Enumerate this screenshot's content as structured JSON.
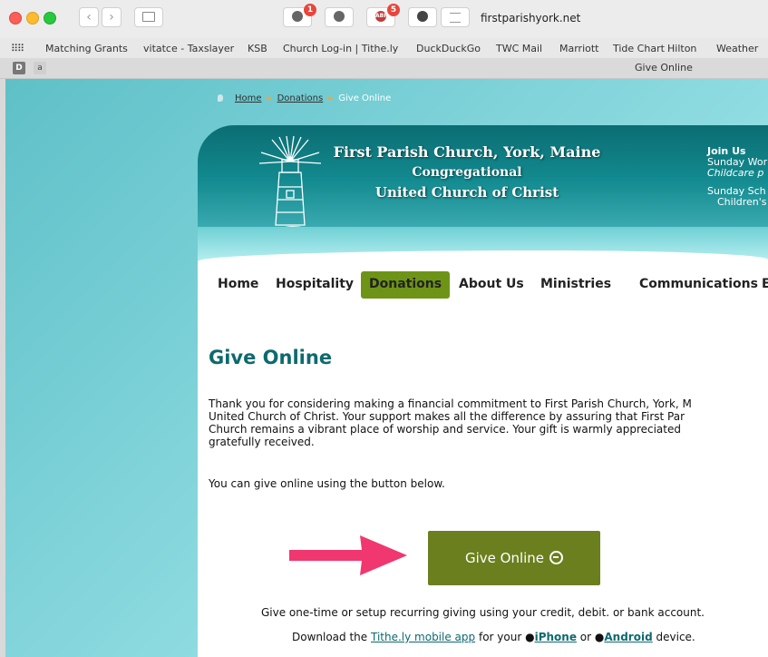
{
  "browser": {
    "url": "firstparishyork.net",
    "tab_title": "Give Online",
    "extension_badges": [
      "1",
      "5"
    ],
    "extension_labels": [
      "ABP"
    ],
    "bookmarks": [
      "Matching Grants",
      "vitatce - Taxslayer",
      "KSB",
      "Church Log-in | Tithe.ly",
      "DuckDuckGo",
      "TWC Mail",
      "Marriott",
      "Tide Chart",
      "Hilton",
      "Weather"
    ],
    "tab_icons": [
      "D",
      "a"
    ]
  },
  "breadcrumb": {
    "home": "Home",
    "donations": "Donations",
    "current": "Give Online",
    "separator": "▸"
  },
  "banner": {
    "title": "First Parish Church, York, Maine",
    "subtitle": "Congregational",
    "ucc": "United Church of Christ",
    "join_title": "Join Us",
    "join_line1": "Sunday Wor",
    "join_line2": "Childcare p",
    "join_line3": "Sunday Sch",
    "join_line4": "Children's"
  },
  "nav": {
    "items": [
      "Home",
      "Hospitality",
      "Donations",
      "About Us",
      "Ministries",
      "Communications",
      "E"
    ],
    "active": "Donations"
  },
  "main": {
    "heading": "Give Online",
    "intro": "Thank you for considering making a financial commitment to First Parish Church, York, M\nUnited Church of Christ.  Your support makes all the difference by assuring that First Par\nChurch remains a vibrant place of worship and service.  Your gift is warmly appreciated\ngratefully received.",
    "instruction": "You can give online using the button below.",
    "give_button": "Give Online",
    "recurring_text": "Give one-time or setup recurring giving using your credit, debit. or bank account.",
    "download_prefix": "Download the",
    "app_link": "Tithe.ly mobile app",
    "for_your": "for your",
    "iphone": "iPhone",
    "or": "or",
    "android": "Android",
    "device": "device."
  },
  "colors": {
    "accent": "#6e9417",
    "heading": "#0d6a6e",
    "arrow": "#f0376f",
    "button": "#6b7f1e"
  }
}
